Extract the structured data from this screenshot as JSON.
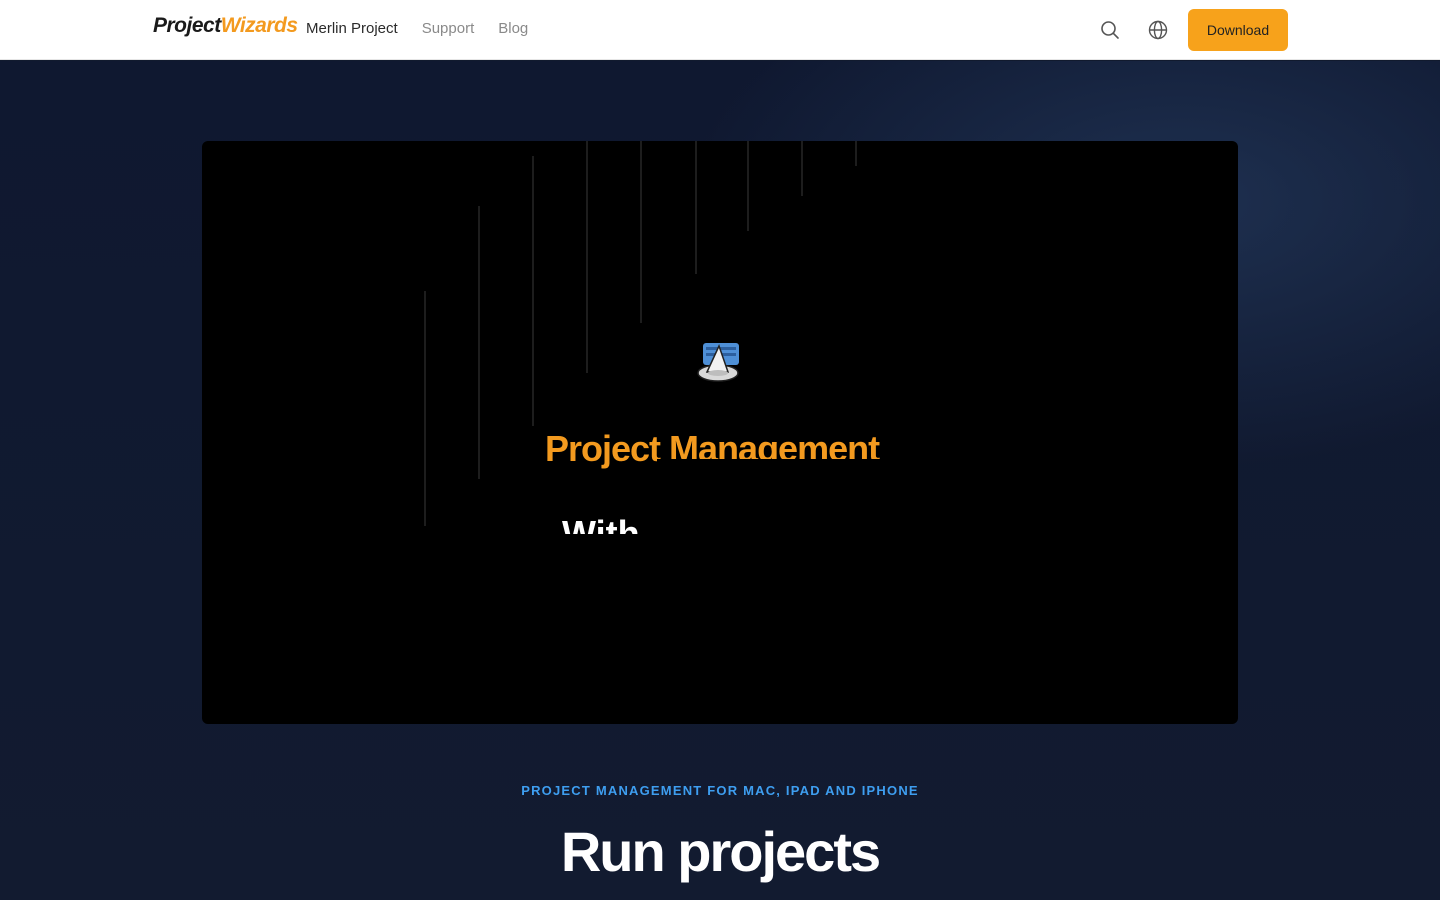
{
  "header": {
    "logo": {
      "part1": "Project",
      "part2": "Wizards"
    },
    "nav": [
      {
        "label": "Merlin Project",
        "active": true
      },
      {
        "label": "Support",
        "active": false
      },
      {
        "label": "Blog",
        "active": false
      }
    ],
    "search_icon": "search-icon",
    "language_icon": "globe-icon",
    "download_label": "Download"
  },
  "hero": {
    "video": {
      "logo_icon": "merlin-wizard-hat-icon",
      "title_orange": "Project Management",
      "title_white": "With"
    },
    "eyebrow": "PROJECT MANAGEMENT FOR MAC, IPAD AND IPHONE",
    "headline": "Run projects"
  },
  "colors": {
    "accent": "#f7a21b",
    "brand_orange": "#f39a1f",
    "eyebrow_blue": "#3e9ef0",
    "hero_bg": "#111a2e",
    "video_bg": "#000000"
  }
}
